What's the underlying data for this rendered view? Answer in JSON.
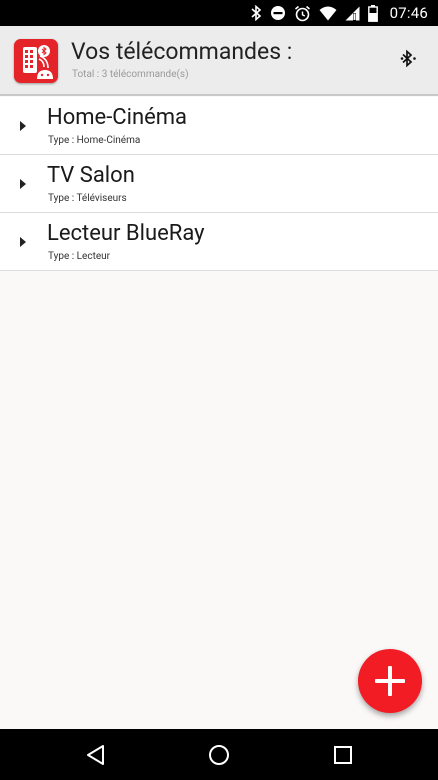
{
  "status_bar": {
    "time": "07:46",
    "icons": [
      "bluetooth-icon",
      "do-not-disturb-icon",
      "alarm-icon",
      "wifi-icon",
      "cell-signal-icon",
      "battery-icon"
    ]
  },
  "app_bar": {
    "title": "Vos télécommandes :",
    "subtitle": "Total : 3 télécommande(s)",
    "bluetooth_icon": "bluetooth-icon"
  },
  "remotes": [
    {
      "name": "Home-Cinéma",
      "type": "Type : Home-Cinéma"
    },
    {
      "name": "TV Salon",
      "type": "Type : Téléviseurs"
    },
    {
      "name": "Lecteur BlueRay",
      "type": "Type : Lecteur"
    }
  ],
  "fab": {
    "icon": "add-icon"
  },
  "nav_bar": {
    "icons": [
      "back-icon",
      "home-icon",
      "recents-icon"
    ]
  },
  "colors": {
    "accent": "#f11c24",
    "app_icon": "#e5242a",
    "app_bar_bg": "#ececec",
    "background": "#fbf8f8"
  }
}
